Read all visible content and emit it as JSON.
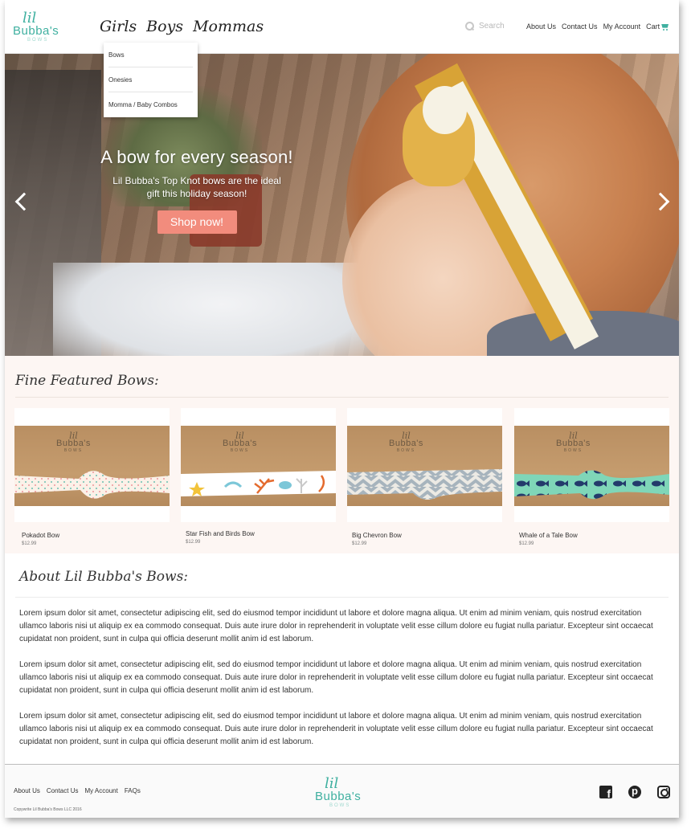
{
  "brand": {
    "lil": "lil",
    "name": "Bubba's",
    "tagline": "BOWS",
    "accent": "#3fb0a0"
  },
  "nav": {
    "main": [
      "Girls",
      "Boys",
      "Mommas"
    ],
    "search_placeholder": "Search",
    "util": [
      "About Us",
      "Contact Us",
      "My Account",
      "Cart"
    ]
  },
  "dropdown": [
    "Bows",
    "Onesies",
    "Momma / Baby Combos"
  ],
  "hero": {
    "title": "A bow for every season!",
    "subtitle": "Lil Bubba's Top Knot bows are the ideal gift this holiday season!",
    "button": "Shop now!",
    "button_color": "#f28c7d"
  },
  "featured": {
    "title": "Fine Featured Bows:",
    "products": [
      {
        "name": "Pokadot Bow",
        "price": "$12.99",
        "pattern": "polka-dot"
      },
      {
        "name": "Star Fish and Birds Bow",
        "price": "$12.99",
        "pattern": "starfish-birds"
      },
      {
        "name": "Big Chevron Bow",
        "price": "$12.99",
        "pattern": "chevron"
      },
      {
        "name": "Whale of a Tale Bow",
        "price": "$12.99",
        "pattern": "whale"
      }
    ]
  },
  "about": {
    "title": "About Lil Bubba's Bows:",
    "paragraphs": [
      "Lorem ipsum dolor sit amet, consectetur adipiscing elit, sed do eiusmod tempor incididunt ut labore et dolore magna aliqua. Ut enim ad minim veniam, quis nostrud exercitation ullamco laboris nisi ut aliquip ex ea commodo consequat. Duis aute irure dolor in reprehenderit in voluptate velit esse cillum dolore eu fugiat nulla pariatur. Excepteur sint occaecat cupidatat non proident, sunt in culpa qui officia deserunt mollit anim id est laborum.",
      "Lorem ipsum dolor sit amet, consectetur adipiscing elit, sed do eiusmod tempor incididunt ut labore et dolore magna aliqua. Ut enim ad minim veniam, quis nostrud exercitation ullamco laboris nisi ut aliquip ex ea commodo consequat. Duis aute irure dolor in reprehenderit in voluptate velit esse cillum dolore eu fugiat nulla pariatur. Excepteur sint occaecat cupidatat non proident, sunt in culpa qui officia deserunt mollit anim id est laborum.",
      "Lorem ipsum dolor sit amet, consectetur adipiscing elit, sed do eiusmod tempor incididunt ut labore et dolore magna aliqua. Ut enim ad minim veniam, quis nostrud exercitation ullamco laboris nisi ut aliquip ex ea commodo consequat. Duis aute irure dolor in reprehenderit in voluptate velit esse cillum dolore eu fugiat nulla pariatur. Excepteur sint occaecat cupidatat non proident, sunt in culpa qui officia deserunt mollit anim id est laborum."
    ]
  },
  "footer": {
    "links": [
      "About Us",
      "Contact Us",
      "My Account",
      "FAQs"
    ],
    "copyright": "Copywrite Lil Bubba's Bows LLC 2016",
    "social": [
      "facebook-icon",
      "pinterest-icon",
      "instagram-icon"
    ]
  }
}
